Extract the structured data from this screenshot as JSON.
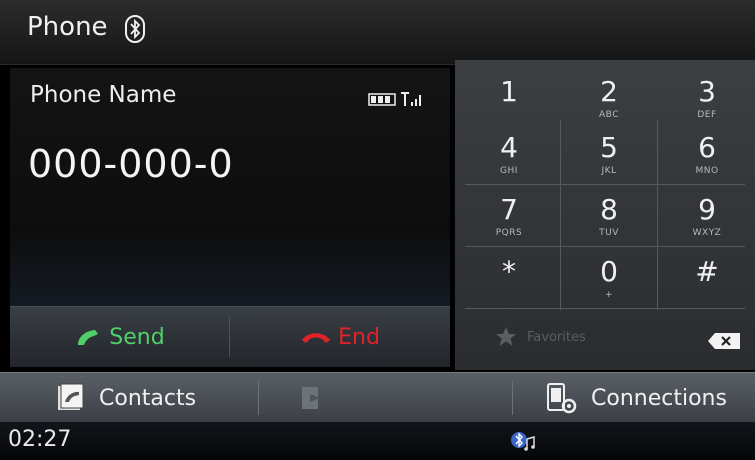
{
  "header": {
    "title": "Phone",
    "bluetooth_icon": "bluetooth-icon"
  },
  "call": {
    "phone_name": "Phone Name",
    "number": "000-000-0",
    "battery_icon": "battery-icon",
    "signal_icon": "signal-icon"
  },
  "call_buttons": {
    "send_label": "Send",
    "end_label": "End"
  },
  "keypad": {
    "keys": [
      {
        "digit": "1",
        "letters": ""
      },
      {
        "digit": "2",
        "letters": "ABC"
      },
      {
        "digit": "3",
        "letters": "DEF"
      },
      {
        "digit": "4",
        "letters": "GHI"
      },
      {
        "digit": "5",
        "letters": "JKL"
      },
      {
        "digit": "6",
        "letters": "MNO"
      },
      {
        "digit": "7",
        "letters": "PQRS"
      },
      {
        "digit": "8",
        "letters": "TUV"
      },
      {
        "digit": "9",
        "letters": "WXYZ"
      },
      {
        "digit": "*",
        "letters": ""
      },
      {
        "digit": "0",
        "letters": "+"
      },
      {
        "digit": "#",
        "letters": ""
      }
    ],
    "favorites_label": "Favorites"
  },
  "menu": {
    "contacts_label": "Contacts",
    "recent_label": "",
    "connections_label": "Connections"
  },
  "status": {
    "time": "02:27"
  },
  "colors": {
    "send": "#4fd06a",
    "end": "#e0222a"
  }
}
